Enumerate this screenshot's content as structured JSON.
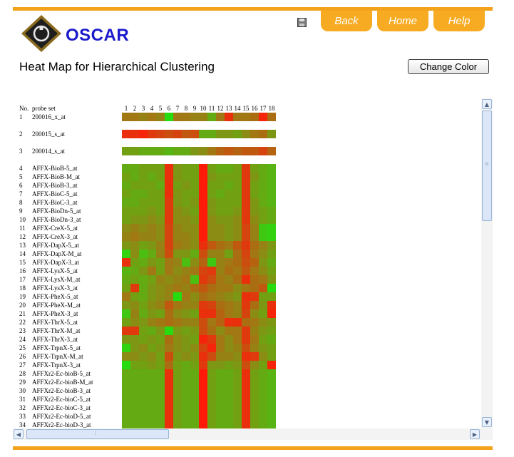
{
  "brand": {
    "name": "OSCAR"
  },
  "nav": {
    "back": "Back",
    "home": "Home",
    "help": "Help"
  },
  "page": {
    "title": "Heat Map for Hierarchical Clustering"
  },
  "toolbar": {
    "change_color_label": "Change Color"
  },
  "icons": {
    "logo": "oscar-logo-icon",
    "save": "floppy-disk-icon",
    "scroll_up": "chevron-up-icon",
    "scroll_down": "chevron-down-icon",
    "scroll_left": "chevron-left-icon",
    "scroll_right": "chevron-right-icon"
  },
  "colors": {
    "accent": "#f3a21c",
    "brand_text": "#1a1acc",
    "high": "#ff1a0a",
    "low": "#1ae610"
  },
  "heatmap": {
    "header_no": "No.",
    "header_probe": "probe set",
    "columns": [
      "1",
      "2",
      "3",
      "4",
      "5",
      "6",
      "7",
      "8",
      "9",
      "10",
      "11",
      "12",
      "13",
      "14",
      "15",
      "16",
      "17",
      "18"
    ],
    "rows": [
      {
        "no": "1",
        "probe": "200016_x_at",
        "cluster": 1
      },
      {
        "no": "2",
        "probe": "200015_s_at",
        "cluster": 2
      },
      {
        "no": "3",
        "probe": "200014_s_at",
        "cluster": 3
      },
      {
        "no": "4",
        "probe": "AFFX-BioB-5_at",
        "cluster": 4
      },
      {
        "no": "5",
        "probe": "AFFX-BioB-M_at",
        "cluster": 4
      },
      {
        "no": "6",
        "probe": "AFFX-BioB-3_at",
        "cluster": 4
      },
      {
        "no": "7",
        "probe": "AFFX-BioC-5_at",
        "cluster": 4
      },
      {
        "no": "8",
        "probe": "AFFX-BioC-3_at",
        "cluster": 4
      },
      {
        "no": "9",
        "probe": "AFFX-BioDn-5_at",
        "cluster": 4
      },
      {
        "no": "10",
        "probe": "AFFX-BioDn-3_at",
        "cluster": 4
      },
      {
        "no": "11",
        "probe": "AFFX-CreX-5_at",
        "cluster": 4
      },
      {
        "no": "12",
        "probe": "AFFX-CreX-3_at",
        "cluster": 4
      },
      {
        "no": "13",
        "probe": "AFFX-DapX-5_at",
        "cluster": 4
      },
      {
        "no": "14",
        "probe": "AFFX-DapX-M_at",
        "cluster": 4
      },
      {
        "no": "15",
        "probe": "AFFX-DapX-3_at",
        "cluster": 4
      },
      {
        "no": "16",
        "probe": "AFFX-LysX-5_at",
        "cluster": 4
      },
      {
        "no": "17",
        "probe": "AFFX-LysX-M_at",
        "cluster": 4
      },
      {
        "no": "18",
        "probe": "AFFX-LysX-3_at",
        "cluster": 4
      },
      {
        "no": "19",
        "probe": "AFFX-PheX-5_at",
        "cluster": 4
      },
      {
        "no": "20",
        "probe": "AFFX-PheX-M_at",
        "cluster": 4
      },
      {
        "no": "21",
        "probe": "AFFX-PheX-3_at",
        "cluster": 4
      },
      {
        "no": "22",
        "probe": "AFFX-ThrX-5_at",
        "cluster": 4
      },
      {
        "no": "23",
        "probe": "AFFX-ThrX-M_at",
        "cluster": 4
      },
      {
        "no": "24",
        "probe": "AFFX-ThrX-3_at",
        "cluster": 4
      },
      {
        "no": "25",
        "probe": "AFFX-TrpnX-5_at",
        "cluster": 4
      },
      {
        "no": "26",
        "probe": "AFFX-TrpnX-M_at",
        "cluster": 4
      },
      {
        "no": "27",
        "probe": "AFFX-TrpnX-3_at",
        "cluster": 4
      },
      {
        "no": "28",
        "probe": "AFFXr2-Ec-bioB-5_at",
        "cluster": 4
      },
      {
        "no": "29",
        "probe": "AFFXr2-Ec-bioB-M_at",
        "cluster": 4
      },
      {
        "no": "30",
        "probe": "AFFXr2-Ec-bioB-3_at",
        "cluster": 4
      },
      {
        "no": "31",
        "probe": "AFFXr2-Ec-bioC-5_at",
        "cluster": 4
      },
      {
        "no": "32",
        "probe": "AFFXr2-Ec-bioC-3_at",
        "cluster": 4
      },
      {
        "no": "33",
        "probe": "AFFXr2-Ec-bioD-5_at",
        "cluster": 4
      },
      {
        "no": "34",
        "probe": "AFFXr2-Ec-bioD-3_at",
        "cluster": 4
      }
    ],
    "values": [
      [
        0.55,
        0.55,
        0.5,
        0.55,
        0.5,
        0.05,
        0.55,
        0.55,
        0.5,
        0.5,
        0.3,
        0.55,
        0.9,
        0.55,
        0.55,
        0.6,
        0.95,
        0.6
      ],
      [
        0.9,
        0.9,
        0.95,
        0.85,
        0.8,
        0.75,
        0.8,
        0.7,
        0.75,
        0.3,
        0.3,
        0.4,
        0.4,
        0.35,
        0.45,
        0.55,
        0.6,
        0.4
      ],
      [
        0.35,
        0.35,
        0.3,
        0.3,
        0.3,
        0.25,
        0.3,
        0.3,
        0.4,
        0.45,
        0.55,
        0.65,
        0.7,
        0.65,
        0.7,
        0.7,
        0.8,
        0.65
      ],
      [
        0.3,
        0.3,
        0.35,
        0.35,
        0.35,
        0.9,
        0.4,
        0.35,
        0.35,
        1.0,
        0.35,
        0.3,
        0.3,
        0.35,
        0.85,
        0.35,
        0.3,
        0.25
      ],
      [
        0.35,
        0.3,
        0.35,
        0.3,
        0.35,
        0.9,
        0.4,
        0.35,
        0.35,
        1.0,
        0.4,
        0.35,
        0.35,
        0.35,
        0.85,
        0.4,
        0.3,
        0.25
      ],
      [
        0.3,
        0.35,
        0.35,
        0.35,
        0.3,
        0.9,
        0.35,
        0.4,
        0.35,
        1.0,
        0.35,
        0.35,
        0.3,
        0.35,
        0.85,
        0.35,
        0.3,
        0.25
      ],
      [
        0.35,
        0.3,
        0.3,
        0.35,
        0.35,
        0.9,
        0.4,
        0.35,
        0.35,
        1.0,
        0.35,
        0.3,
        0.35,
        0.35,
        0.85,
        0.35,
        0.3,
        0.25
      ],
      [
        0.3,
        0.3,
        0.35,
        0.35,
        0.35,
        0.85,
        0.4,
        0.35,
        0.4,
        1.0,
        0.4,
        0.35,
        0.35,
        0.35,
        0.85,
        0.4,
        0.3,
        0.25
      ],
      [
        0.35,
        0.35,
        0.35,
        0.4,
        0.35,
        0.85,
        0.45,
        0.4,
        0.35,
        1.0,
        0.4,
        0.35,
        0.35,
        0.4,
        0.85,
        0.4,
        0.35,
        0.3
      ],
      [
        0.35,
        0.4,
        0.4,
        0.45,
        0.4,
        0.85,
        0.45,
        0.45,
        0.4,
        1.0,
        0.45,
        0.4,
        0.4,
        0.45,
        0.85,
        0.45,
        0.35,
        0.3
      ],
      [
        0.45,
        0.5,
        0.45,
        0.5,
        0.45,
        0.8,
        0.5,
        0.45,
        0.45,
        1.0,
        0.45,
        0.45,
        0.4,
        0.45,
        0.8,
        0.5,
        0.15,
        0.1
      ],
      [
        0.5,
        0.55,
        0.5,
        0.5,
        0.45,
        0.8,
        0.5,
        0.5,
        0.45,
        1.0,
        0.45,
        0.45,
        0.4,
        0.45,
        0.8,
        0.5,
        0.15,
        0.1
      ],
      [
        0.4,
        0.45,
        0.35,
        0.4,
        0.5,
        0.8,
        0.55,
        0.5,
        0.45,
        0.9,
        0.7,
        0.6,
        0.55,
        0.7,
        0.85,
        0.6,
        0.5,
        0.4
      ],
      [
        0.1,
        0.45,
        0.2,
        0.3,
        0.5,
        0.75,
        0.4,
        0.4,
        0.3,
        0.75,
        0.5,
        0.5,
        0.35,
        0.6,
        0.8,
        0.55,
        0.45,
        0.35
      ],
      [
        0.9,
        0.35,
        0.3,
        0.4,
        0.35,
        0.55,
        0.5,
        0.2,
        0.45,
        0.65,
        0.15,
        0.5,
        0.55,
        0.6,
        0.75,
        0.65,
        0.4,
        0.3
      ],
      [
        0.25,
        0.3,
        0.4,
        0.55,
        0.35,
        0.55,
        0.45,
        0.5,
        0.55,
        0.8,
        0.85,
        0.5,
        0.6,
        0.55,
        0.7,
        0.55,
        0.45,
        0.35
      ],
      [
        0.3,
        0.35,
        0.3,
        0.35,
        0.5,
        0.45,
        0.5,
        0.55,
        0.2,
        0.85,
        0.75,
        0.55,
        0.5,
        0.6,
        0.9,
        0.6,
        0.55,
        0.4
      ],
      [
        0.35,
        0.85,
        0.3,
        0.4,
        0.45,
        0.5,
        0.55,
        0.5,
        0.6,
        0.7,
        0.6,
        0.55,
        0.55,
        0.45,
        0.55,
        0.6,
        0.7,
        0.05
      ],
      [
        0.55,
        0.35,
        0.3,
        0.4,
        0.45,
        0.5,
        0.05,
        0.55,
        0.45,
        0.6,
        0.55,
        0.5,
        0.45,
        0.4,
        0.9,
        0.85,
        0.35,
        0.35
      ],
      [
        0.4,
        0.45,
        0.35,
        0.45,
        0.5,
        0.7,
        0.55,
        0.5,
        0.5,
        0.85,
        0.8,
        0.6,
        0.55,
        0.5,
        0.85,
        0.6,
        0.4,
        0.9
      ],
      [
        0.15,
        0.5,
        0.3,
        0.4,
        0.35,
        0.6,
        0.45,
        0.4,
        0.35,
        0.9,
        0.9,
        0.65,
        0.55,
        0.5,
        0.8,
        0.45,
        0.35,
        0.95
      ],
      [
        0.35,
        0.45,
        0.4,
        0.5,
        0.55,
        0.6,
        0.55,
        0.5,
        0.5,
        0.75,
        0.55,
        0.65,
        0.9,
        0.9,
        0.6,
        0.55,
        0.45,
        0.4
      ],
      [
        0.85,
        0.85,
        0.35,
        0.3,
        0.4,
        0.05,
        0.4,
        0.35,
        0.4,
        0.75,
        0.6,
        0.45,
        0.55,
        0.55,
        0.85,
        0.5,
        0.4,
        0.35
      ],
      [
        0.4,
        0.4,
        0.35,
        0.4,
        0.35,
        0.6,
        0.45,
        0.4,
        0.35,
        0.95,
        0.85,
        0.55,
        0.45,
        0.55,
        0.85,
        0.55,
        0.35,
        0.3
      ],
      [
        0.1,
        0.4,
        0.45,
        0.35,
        0.4,
        0.55,
        0.45,
        0.4,
        0.45,
        0.8,
        0.95,
        0.55,
        0.45,
        0.5,
        0.75,
        0.5,
        0.4,
        0.35
      ],
      [
        0.45,
        0.45,
        0.4,
        0.45,
        0.35,
        0.75,
        0.4,
        0.45,
        0.4,
        0.9,
        0.75,
        0.5,
        0.5,
        0.45,
        0.9,
        0.85,
        0.45,
        0.35
      ],
      [
        0.05,
        0.35,
        0.35,
        0.4,
        0.35,
        0.6,
        0.35,
        0.3,
        0.35,
        0.85,
        0.4,
        0.4,
        0.35,
        0.4,
        0.75,
        0.45,
        0.35,
        0.95
      ],
      [
        0.3,
        0.3,
        0.3,
        0.3,
        0.3,
        0.9,
        0.35,
        0.3,
        0.3,
        1.0,
        0.35,
        0.3,
        0.3,
        0.35,
        0.9,
        0.35,
        0.3,
        0.25
      ],
      [
        0.3,
        0.3,
        0.3,
        0.3,
        0.3,
        0.9,
        0.35,
        0.3,
        0.3,
        1.0,
        0.35,
        0.3,
        0.3,
        0.35,
        0.9,
        0.35,
        0.3,
        0.25
      ],
      [
        0.3,
        0.3,
        0.3,
        0.3,
        0.3,
        0.9,
        0.35,
        0.3,
        0.3,
        1.0,
        0.35,
        0.3,
        0.3,
        0.35,
        0.9,
        0.35,
        0.3,
        0.25
      ],
      [
        0.3,
        0.3,
        0.3,
        0.3,
        0.3,
        0.9,
        0.35,
        0.3,
        0.3,
        1.0,
        0.35,
        0.3,
        0.3,
        0.35,
        0.9,
        0.35,
        0.3,
        0.25
      ],
      [
        0.3,
        0.3,
        0.3,
        0.3,
        0.3,
        0.9,
        0.35,
        0.3,
        0.3,
        1.0,
        0.35,
        0.3,
        0.3,
        0.35,
        0.9,
        0.35,
        0.3,
        0.25
      ],
      [
        0.3,
        0.3,
        0.3,
        0.3,
        0.3,
        0.9,
        0.35,
        0.3,
        0.3,
        1.0,
        0.35,
        0.3,
        0.3,
        0.35,
        0.9,
        0.35,
        0.3,
        0.25
      ],
      [
        0.3,
        0.3,
        0.3,
        0.3,
        0.3,
        0.9,
        0.35,
        0.3,
        0.3,
        1.0,
        0.35,
        0.3,
        0.3,
        0.35,
        0.9,
        0.35,
        0.3,
        0.25
      ]
    ]
  }
}
